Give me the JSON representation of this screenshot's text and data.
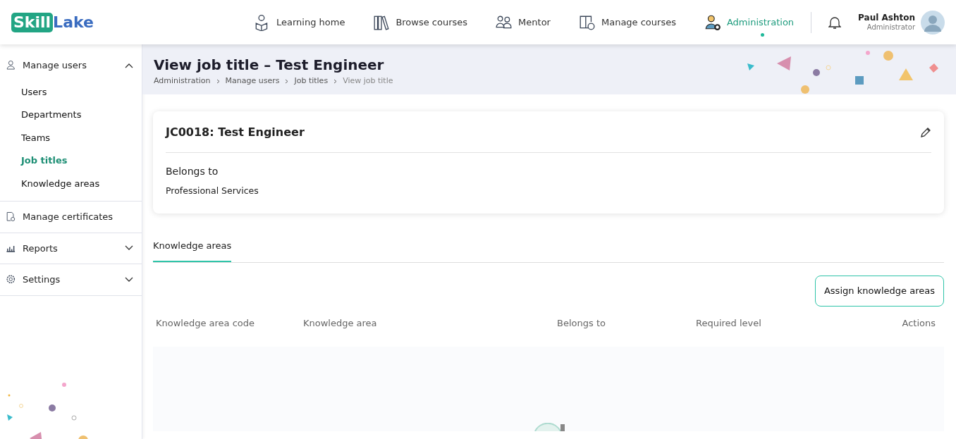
{
  "logo": {
    "part_1": "Skill",
    "part_2": "Lake"
  },
  "nav": [
    {
      "label": "Learning home",
      "selected": false
    },
    {
      "label": "Browse courses",
      "selected": false
    },
    {
      "label": "Mentor",
      "selected": false
    },
    {
      "label": "Manage courses",
      "selected": false
    },
    {
      "label": "Administration",
      "selected": true
    }
  ],
  "user": {
    "name": "Paul Ashton",
    "role": "Administrator"
  },
  "sidebar": {
    "items": [
      {
        "label": "Manage users",
        "expanded": true,
        "children": [
          {
            "label": "Users",
            "selected": false
          },
          {
            "label": "Departments",
            "selected": false
          },
          {
            "label": "Teams",
            "selected": false
          },
          {
            "label": "Job titles",
            "selected": true
          },
          {
            "label": "Knowledge areas",
            "selected": false
          }
        ]
      },
      {
        "label": "Manage certificates"
      },
      {
        "label": "Reports",
        "expanded": false
      },
      {
        "label": "Settings",
        "expanded": false
      }
    ]
  },
  "page": {
    "title": "View job title – Test Engineer",
    "breadcrumb": [
      "Administration",
      "Manage users",
      "Job titles",
      "View job title"
    ]
  },
  "card": {
    "title": "JC0018: Test Engineer",
    "field_label": "Belongs to",
    "field_value": "Professional Services"
  },
  "tabs": [
    {
      "label": "Knowledge areas",
      "selected": true
    }
  ],
  "assign_button": "Assign knowledge areas",
  "table": {
    "columns": [
      "Knowledge area code",
      "Knowledge area",
      "Belongs to",
      "Required level",
      "Actions"
    ]
  }
}
